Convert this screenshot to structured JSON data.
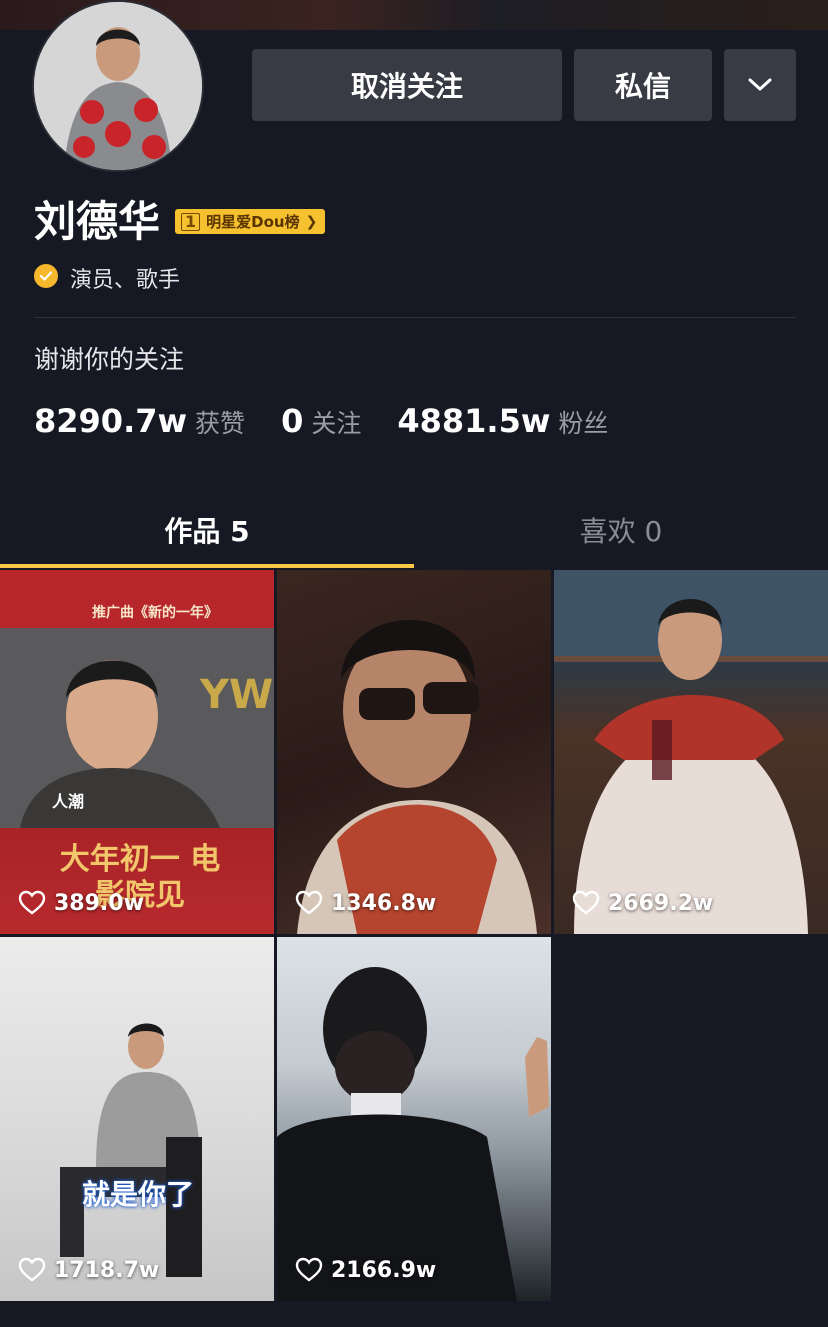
{
  "header": {
    "unfollow_label": "取消关注",
    "message_label": "私信"
  },
  "profile": {
    "name": "刘德华",
    "rank_number": "1",
    "rank_label": "明星爱Dou榜",
    "verification": "演员、歌手",
    "bio": "谢谢你的关注"
  },
  "stats": {
    "likes_value": "8290.7w",
    "likes_label": "获赞",
    "following_value": "0",
    "following_label": "关注",
    "followers_value": "4881.5w",
    "followers_label": "粉丝"
  },
  "tabs": {
    "works": "作品 5",
    "likes": "喜欢 0"
  },
  "videos": [
    {
      "likes": "389.0w",
      "overlay_top": "推广曲《新的一年》",
      "overlay_bottom": "大年初一 电影院见",
      "overlay_logo": "人潮"
    },
    {
      "likes": "1346.8w"
    },
    {
      "likes": "2669.2w"
    },
    {
      "likes": "1718.7w",
      "overlay_caption": "就是你了"
    },
    {
      "likes": "2166.9w"
    }
  ],
  "colors": {
    "background": "#161823",
    "button": "#393b44",
    "accent": "#f8c946",
    "badge": "#f6c12f"
  }
}
